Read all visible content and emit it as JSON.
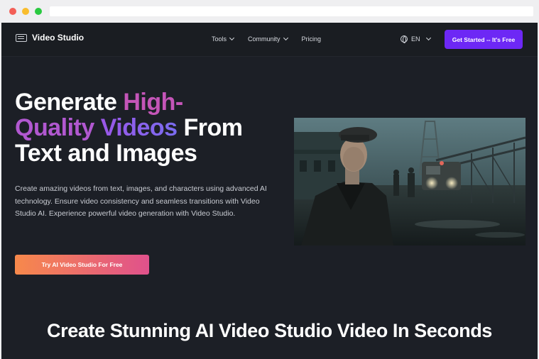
{
  "brand": {
    "name": "Video Studio",
    "icon": "film-icon"
  },
  "nav": {
    "links": [
      {
        "label": "Tools",
        "has_dropdown": true
      },
      {
        "label": "Community",
        "has_dropdown": true
      },
      {
        "label": "Pricing",
        "has_dropdown": false
      }
    ],
    "language": "EN",
    "language_icon": "globe-icon",
    "cta": "Get Started -- It's Free"
  },
  "hero": {
    "title_part1": "Generate ",
    "title_highlight1": "High-",
    "title_highlight2a": "Quality",
    "title_highlight2b": " Videos",
    "title_part2": " From",
    "title_part3": "Text and Images",
    "description": "Create amazing videos from text, images, and characters using advanced AI technology. Ensure video consistency and seamless transitions with Video Studio AI. Experience powerful video generation with Video Studio.",
    "button": "Try AI Video Studio For Free"
  },
  "section": {
    "title": "Create Stunning AI Video Studio Video In Seconds"
  },
  "colors": {
    "accent_purple": "#6d28f5",
    "highlight_pink": "#c455b8",
    "highlight_violet": "#7a6cf0",
    "button_gradient_start": "#f7894b",
    "button_gradient_end": "#e0518c",
    "page_background": "#1c1f26"
  }
}
